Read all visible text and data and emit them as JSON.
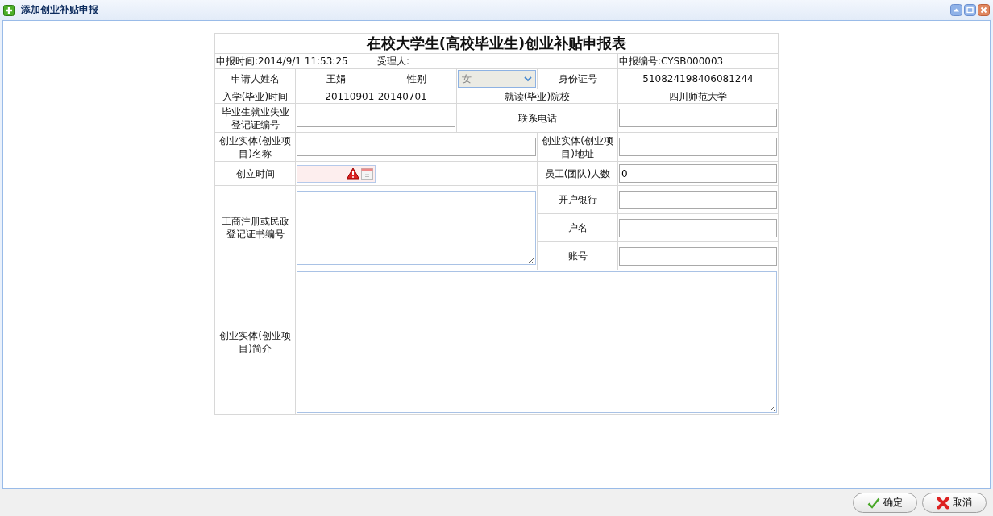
{
  "window": {
    "title": "添加创业补贴申报"
  },
  "form": {
    "title": "在校大学生(高校毕业生)创业补贴申报表",
    "report_time": "申报时间:2014/9/1 11:53:25",
    "receiver": "受理人:",
    "report_no": "申报编号:CYSB000003",
    "applicant_name": {
      "label": "申请人姓名",
      "value": "王娟"
    },
    "gender": {
      "label": "性别",
      "value": "女",
      "disabled": true
    },
    "id_number": {
      "label": "身份证号",
      "value": "510824198406081244"
    },
    "enrollment_period": {
      "label": "入学(毕业)时间",
      "value": "20110901-20140701"
    },
    "school": {
      "label": "就读(毕业)院校",
      "value": "四川师范大学"
    },
    "registration_no": {
      "label": "毕业生就业失业登记证编号"
    },
    "phone": {
      "label": "联系电话"
    },
    "entity_name": {
      "label": "创业实体(创业项目)名称"
    },
    "entity_address": {
      "label": "创业实体(创业项目)地址"
    },
    "founded_date": {
      "label": "创立时间",
      "invalid": true
    },
    "staff_count": {
      "label": "员工(团队)人数",
      "value": "0"
    },
    "license_no": {
      "label": "工商注册或民政登记证书编号"
    },
    "bank": {
      "label": "开户银行"
    },
    "account_name": {
      "label": "户名"
    },
    "account_no": {
      "label": "账号"
    },
    "description": {
      "label": "创业实体(创业项目)简介"
    }
  },
  "buttons": [
    {
      "label": "确定",
      "kind": "confirm"
    },
    {
      "label": "取消",
      "kind": "cancel"
    }
  ]
}
